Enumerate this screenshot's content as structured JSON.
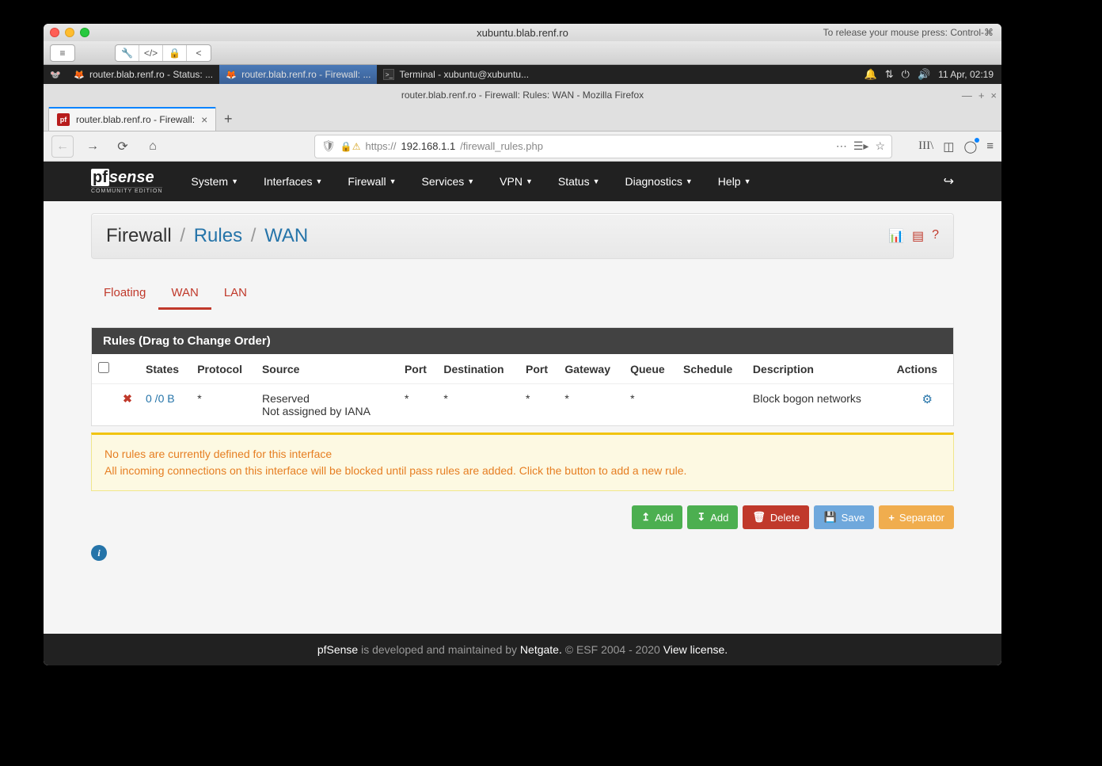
{
  "mac": {
    "title": "xubuntu.blab.renf.ro",
    "release_hint": "To release your mouse press: Control-⌘"
  },
  "toolbar_icons": [
    "🔧",
    "</>",
    "🔒",
    "<"
  ],
  "ubuntu": {
    "apps": [
      {
        "icon": "🐭",
        "label": ""
      },
      {
        "icon": "🦊",
        "label": "router.blab.renf.ro - Status: ..."
      },
      {
        "icon": "🦊",
        "label": "router.blab.renf.ro - Firewall: ...",
        "active": true
      },
      {
        "icon": "＞_",
        "label": "Terminal - xubuntu@xubuntu..."
      }
    ],
    "datetime": "11 Apr, 02:19"
  },
  "firefox": {
    "title": "router.blab.renf.ro - Firewall: Rules: WAN - Mozilla Firefox",
    "tab_label": "router.blab.renf.ro - Firewall:",
    "url": {
      "proto": "https://",
      "host": "192.168.1.1",
      "path": "/firewall_rules.php"
    }
  },
  "pfsense": {
    "logo_sub": "COMMUNITY EDITION",
    "menu": [
      "System",
      "Interfaces",
      "Firewall",
      "Services",
      "VPN",
      "Status",
      "Diagnostics",
      "Help"
    ],
    "breadcrumb": {
      "a": "Firewall",
      "b": "Rules",
      "c": "WAN"
    },
    "tabs": [
      "Floating",
      "WAN",
      "LAN"
    ],
    "panel_title": "Rules (Drag to Change Order)",
    "columns": [
      "",
      "",
      "States",
      "Protocol",
      "Source",
      "Port",
      "Destination",
      "Port",
      "Gateway",
      "Queue",
      "Schedule",
      "Description",
      "Actions"
    ],
    "row": {
      "states": "0 /0 B",
      "protocol": "*",
      "source": "Reserved\nNot assigned by IANA",
      "port1": "*",
      "destination": "*",
      "port2": "*",
      "gateway": "*",
      "queue": "*",
      "schedule": "",
      "description": "Block bogon networks"
    },
    "alert_line1": "No rules are currently defined for this interface",
    "alert_line2": "All incoming connections on this interface will be blocked until pass rules are added. Click the button to add a new rule.",
    "buttons": {
      "add1": "Add",
      "add2": "Add",
      "delete": "Delete",
      "save": "Save",
      "separator": "Separator"
    },
    "footer": {
      "a": "pfSense",
      "b": " is developed and maintained by ",
      "c": "Netgate.",
      "d": " © ESF 2004 - 2020 ",
      "e": "View license."
    }
  }
}
